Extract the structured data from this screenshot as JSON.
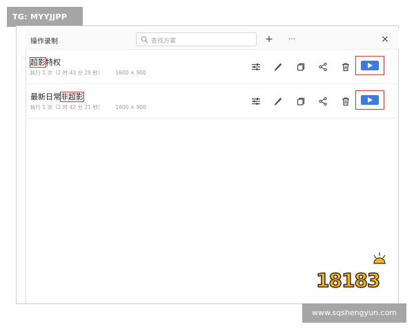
{
  "watermarks": {
    "top_left": "TG: MYYJJPP",
    "bottom_right": "www.sqshengyun.com",
    "logo": "18183"
  },
  "window": {
    "title": "操作录制",
    "search_placeholder": "查找方案",
    "add_label": "+",
    "more_label": "···",
    "close_label": "×"
  },
  "icons": [
    "sliders-icon",
    "pencil-icon",
    "copy-icon",
    "share-icon",
    "trash-icon",
    "play-icon"
  ],
  "accent_color": "#3b7be0",
  "highlight_color": "#c9302c",
  "plans": [
    {
      "name_pre": "",
      "name_hl": "超影",
      "name_post": "特权",
      "runs": "执行 1 次（2 时 43 分 29 秒）",
      "resolution": "1600 × 900"
    },
    {
      "name_pre": "最新日常",
      "name_hl": "非超影",
      "name_post": "",
      "runs": "执行 1 次（2 时 42 分 21 秒）",
      "resolution": "1600 × 900"
    }
  ]
}
